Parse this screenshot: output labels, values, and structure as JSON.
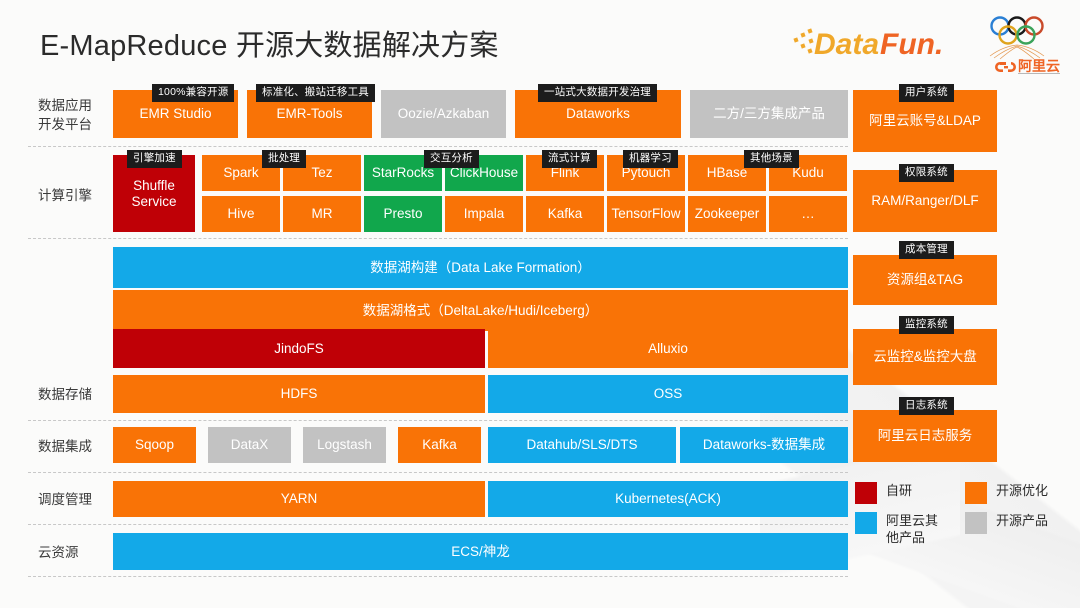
{
  "header": {
    "title": "E-MapReduce 开源大数据解决方案",
    "logo_datafun": "DataFun.",
    "logo_aliyun": "阿里云"
  },
  "row_labels": [
    {
      "id": "app-platform",
      "text": "数据应用\n开发平台"
    },
    {
      "id": "compute-engine",
      "text": "计算引擎"
    },
    {
      "id": "data-storage",
      "text": "数据存储"
    },
    {
      "id": "data-integration",
      "text": "数据集成"
    },
    {
      "id": "schedule-mgmt",
      "text": "调度管理"
    },
    {
      "id": "cloud-resource",
      "text": "云资源"
    }
  ],
  "tags": {
    "compat_open_source": "100%兼容开源",
    "standardize_migrate": "标准化、搬站迁移工具",
    "one_stop_bigdata": "一站式大数据开发治理",
    "user_system": "用户系统",
    "engine_accel": "引擎加速",
    "batch_process": "批处理",
    "interactive_analysis": "交互分析",
    "stream_compute": "流式计算",
    "machine_learning": "机器学习",
    "other_scenarios": "其他场景",
    "permission_system": "权限系统",
    "cost_management": "成本管理",
    "monitor_system": "监控系统",
    "log_system": "日志系统"
  },
  "app_platform": [
    {
      "label": "EMR Studio",
      "color": "orange"
    },
    {
      "label": "EMR-Tools",
      "color": "orange"
    },
    {
      "label": "Oozie/Azkaban",
      "color": "gray"
    },
    {
      "label": "Dataworks",
      "color": "orange"
    },
    {
      "label": "二方/三方集成产品",
      "color": "gray"
    }
  ],
  "compute_engine": {
    "shuffle": {
      "label": "Shuffle\nService",
      "color": "red"
    },
    "cells_top": [
      {
        "label": "Spark",
        "color": "orange"
      },
      {
        "label": "Tez",
        "color": "orange"
      },
      {
        "label": "StarRocks",
        "color": "green"
      },
      {
        "label": "ClickHouse",
        "color": "green"
      },
      {
        "label": "Flink",
        "color": "orange"
      },
      {
        "label": "Pytouch",
        "color": "orange"
      },
      {
        "label": "HBase",
        "color": "orange"
      },
      {
        "label": "Kudu",
        "color": "orange"
      }
    ],
    "cells_bottom": [
      {
        "label": "Hive",
        "color": "orange"
      },
      {
        "label": "MR",
        "color": "orange"
      },
      {
        "label": "Presto",
        "color": "green"
      },
      {
        "label": "Impala",
        "color": "orange"
      },
      {
        "label": "Kafka",
        "color": "orange"
      },
      {
        "label": "TensorFlow",
        "color": "orange"
      },
      {
        "label": "Zookeeper",
        "color": "orange"
      },
      {
        "label": "…",
        "color": "orange"
      }
    ]
  },
  "storage_stack": {
    "lake_formation": {
      "label": "数据湖构建（Data Lake Formation）",
      "color": "blue"
    },
    "lake_format": {
      "label": "数据湖格式（DeltaLake/Hudi/Iceberg）",
      "color": "orange"
    },
    "cache_left": {
      "label": "JindoFS",
      "color": "red"
    },
    "cache_right": {
      "label": "Alluxio",
      "color": "orange"
    },
    "fs_left": {
      "label": "HDFS",
      "color": "orange"
    },
    "fs_right": {
      "label": "OSS",
      "color": "blue"
    }
  },
  "data_integration": [
    {
      "label": "Sqoop",
      "color": "orange"
    },
    {
      "label": "DataX",
      "color": "gray"
    },
    {
      "label": "Logstash",
      "color": "gray"
    },
    {
      "label": "Kafka",
      "color": "orange"
    },
    {
      "label": "Datahub/SLS/DTS",
      "color": "blue"
    },
    {
      "label": "Dataworks-数据集成",
      "color": "blue"
    }
  ],
  "schedule": [
    {
      "label": "YARN",
      "color": "orange"
    },
    {
      "label": "Kubernetes(ACK)",
      "color": "blue"
    }
  ],
  "cloud_resource": [
    {
      "label": "ECS/神龙",
      "color": "blue"
    }
  ],
  "sidebar": [
    {
      "tag": "用户系统",
      "label": "阿里云账号&LDAP",
      "color": "orange"
    },
    {
      "tag": "权限系统",
      "label": "RAM/Ranger/DLF",
      "color": "orange"
    },
    {
      "tag": "成本管理",
      "label": "资源组&TAG",
      "color": "orange"
    },
    {
      "tag": "监控系统",
      "label": "云监控&监控大盘",
      "color": "orange"
    },
    {
      "tag": "日志系统",
      "label": "阿里云日志服务",
      "color": "orange"
    }
  ],
  "legend": [
    {
      "label": "自研",
      "color": "red",
      "hex": "#bf0006"
    },
    {
      "label": "开源优化",
      "color": "orange",
      "hex": "#f97306"
    },
    {
      "label": "阿里云其他产品",
      "color": "blue",
      "hex": "#13a9e8"
    },
    {
      "label": "开源产品",
      "color": "gray",
      "hex": "#c2c2c2"
    }
  ],
  "colors": {
    "orange": "#f97306",
    "gray": "#c2c2c2",
    "blue": "#13a9e8",
    "red": "#bf0006",
    "green": "#11a74c",
    "tag_bg": "#1c1c1c",
    "background": "#fbfbfa"
  }
}
